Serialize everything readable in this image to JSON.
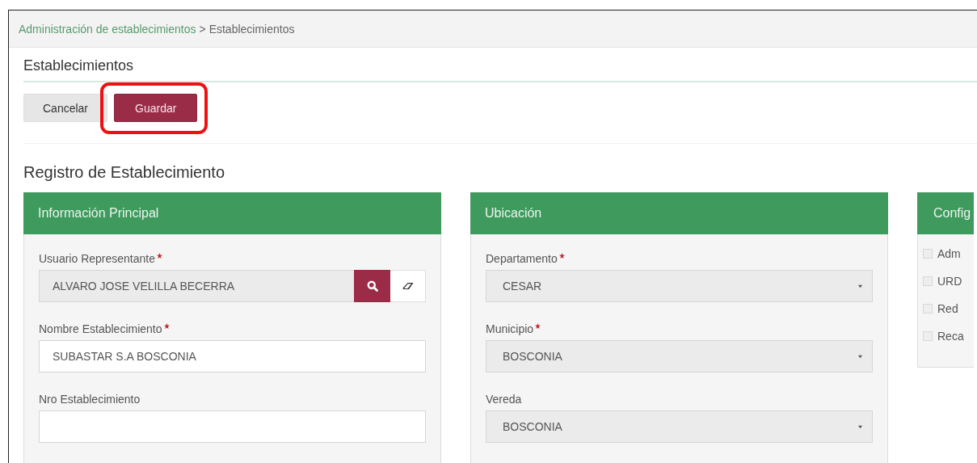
{
  "breadcrumb": {
    "parent": "Administración de establecimientos",
    "separator": ">",
    "current": "Establecimientos"
  },
  "page_title": "Establecimientos",
  "buttons": [
    {
      "label": "Cancelar",
      "kind": "default",
      "highlighted": false
    },
    {
      "label": "Guardar",
      "kind": "primary",
      "highlighted": true
    }
  ],
  "section_title": "Registro de Establecimiento",
  "panels": [
    {
      "title": "Información Principal",
      "fields": [
        {
          "kind": "lookup",
          "label": "Usuario Representante",
          "required": true,
          "value": "ALVARO JOSE VELILLA BECERRA"
        },
        {
          "kind": "text",
          "label": "Nombre Establecimiento",
          "required": true,
          "value": "SUBASTAR S.A BOSCONIA"
        },
        {
          "kind": "text",
          "label": "Nro Establecimiento",
          "required": false
        }
      ]
    },
    {
      "title": "Ubicación",
      "fields": [
        {
          "kind": "select",
          "label": "Departamento",
          "required": true,
          "value": "CESAR"
        },
        {
          "kind": "select",
          "label": "Municipio",
          "required": true,
          "value": "BOSCONIA"
        },
        {
          "kind": "select",
          "label": "Vereda",
          "required": false,
          "value": "BOSCONIA"
        }
      ]
    },
    {
      "title": "Config",
      "fields": [
        {
          "kind": "checkbox",
          "label": "Adm",
          "checked": false
        },
        {
          "kind": "checkbox",
          "label": "URD",
          "checked": false
        },
        {
          "kind": "checkbox",
          "label": "Red",
          "checked": false
        },
        {
          "kind": "checkbox",
          "label": "Reca",
          "checked": false
        }
      ]
    }
  ]
}
